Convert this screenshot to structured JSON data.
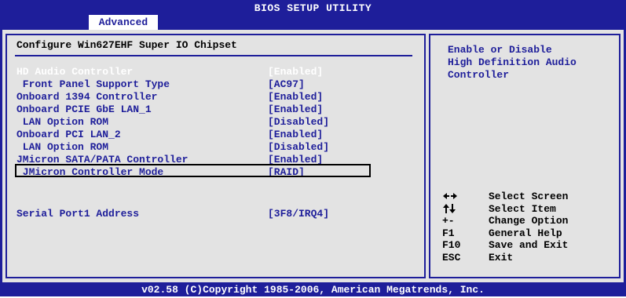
{
  "title": "BIOS SETUP UTILITY",
  "active_tab": "Advanced",
  "section_title": "Configure Win627EHF Super IO Chipset",
  "settings": [
    {
      "label": "HD Audio Controller",
      "value": "[Enabled]"
    },
    {
      "label": " Front Panel Support Type",
      "value": "[AC97]"
    },
    {
      "label": "Onboard 1394 Controller",
      "value": "[Enabled]"
    },
    {
      "label": "Onboard PCIE GbE LAN_1",
      "value": "[Enabled]"
    },
    {
      "label": " LAN Option ROM",
      "value": "[Disabled]"
    },
    {
      "label": "Onboard PCI LAN_2",
      "value": "[Enabled]"
    },
    {
      "label": " LAN Option ROM",
      "value": "[Disabled]"
    },
    {
      "label": "JMicron SATA/PATA Controller",
      "value": "[Enabled]"
    },
    {
      "label": " JMicron Controller Mode",
      "value": "[RAID]"
    },
    {
      "label": "Serial Port1 Address",
      "value": "[3F8/IRQ4]"
    }
  ],
  "help_text": "Enable or Disable\nHigh Definition Audio\nController",
  "keys": [
    {
      "key": "←→",
      "icon": "left-right-arrows-icon",
      "desc": "Select Screen"
    },
    {
      "key": "↑↓",
      "icon": "up-down-arrows-icon",
      "desc": "Select Item"
    },
    {
      "key": "+-",
      "desc": "Change Option"
    },
    {
      "key": "F1",
      "desc": "General Help"
    },
    {
      "key": "F10",
      "desc": "Save and Exit"
    },
    {
      "key": "ESC",
      "desc": "Exit"
    }
  ],
  "footer": "v02.58 (C)Copyright 1985-2006, American Megatrends, Inc.",
  "colors": {
    "bios_blue": "#1e1e9a",
    "panel_gray": "#e3e3e3",
    "highlight": "#ffffff"
  }
}
